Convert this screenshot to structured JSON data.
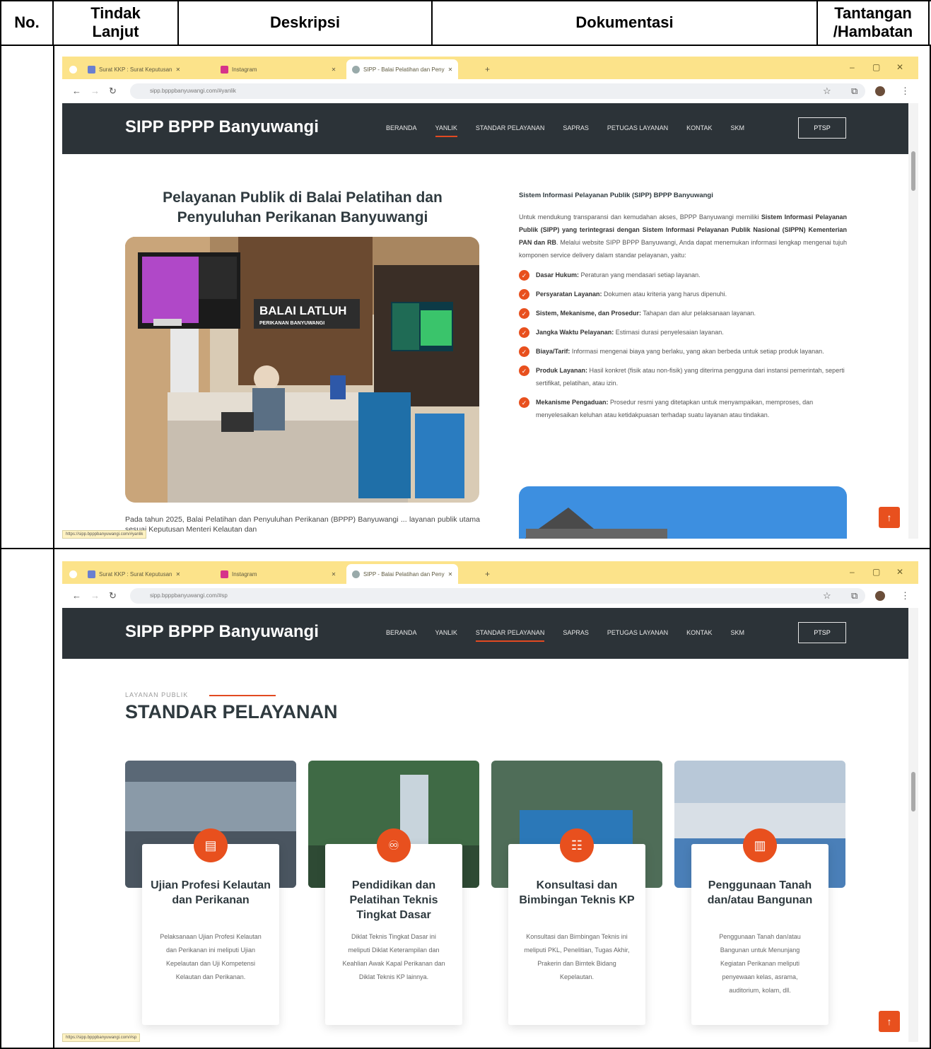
{
  "table": {
    "headers": [
      "No.",
      "Tindak Lanjut",
      "Deskripsi",
      "Dokumentasi",
      "Tantangan /Hambatan"
    ]
  },
  "browser": {
    "tabs": [
      "Surat KKP : Surat Keputusan",
      "Instagram",
      "SIPP - Balai Pelatihan dan Peny"
    ],
    "window_controls": [
      "–",
      "▢",
      "✕"
    ],
    "url1": "sipp.bpppbanyuwangi.com/#yanlik",
    "url2": "sipp.bpppbanyuwangi.com/#sp",
    "status1": "https://sipp.bpppbanyuwangi.com/#yanlik",
    "status2": "https://sipp.bpppbanyuwangi.com/#sp"
  },
  "site": {
    "brand": "SIPP BPPP Banyuwangi",
    "nav": [
      "BERANDA",
      "YANLIK",
      "STANDAR PELAYANAN",
      "SAPRAS",
      "PETUGAS LAYANAN",
      "KONTAK",
      "SKM"
    ],
    "ptsp": "PTSP"
  },
  "shot1": {
    "title": "Pelayanan Publik di Balai Pelatihan dan Penyuluhan Perikanan Banyuwangi",
    "photo_sign_1": "BALAI LATLUH",
    "photo_sign_2": "PERIKANAN BANYUWANGI",
    "para": "Pada tahun 2025, Balai Pelatihan dan Penyuluhan Perikanan (BPPP) Banyuwangi ... layanan publik utama sesuai Keputusan Menteri Kelautan dan",
    "right_heading": "Sistem Informasi Pelayanan Publik (SIPP) BPPP Banyuwangi",
    "right_intro_a": "Untuk mendukung transparansi dan kemudahan akses, BPPP Banyuwangi memiliki ",
    "right_intro_b": "Sistem Informasi Pelayanan Publik (SIPP) yang terintegrasi dengan Sistem Informasi Pelayanan Publik Nasional (SIPPN) Kementerian PAN dan RB",
    "right_intro_c": ". Melalui website SIPP BPPP Banyuwangi, Anda dapat menemukan informasi lengkap mengenai tujuh komponen service delivery dalam standar pelayanan, yaitu:",
    "items": [
      {
        "term": "Dasar Hukum:",
        "desc": " Peraturan yang mendasari setiap layanan."
      },
      {
        "term": "Persyaratan Layanan:",
        "desc": " Dokumen atau kriteria yang harus dipenuhi."
      },
      {
        "term": "Sistem, Mekanisme, dan Prosedur:",
        "desc": " Tahapan dan alur pelaksanaan layanan."
      },
      {
        "term": "Jangka Waktu Pelayanan:",
        "desc": " Estimasi durasi penyelesaian layanan."
      },
      {
        "term": "Biaya/Tarif:",
        "desc": " Informasi mengenai biaya yang berlaku, yang akan berbeda untuk setiap produk layanan."
      },
      {
        "term": "Produk Layanan:",
        "desc": " Hasil konkret (fisik atau non-fisik) yang diterima pengguna dari instansi pemerintah, seperti sertifikat, pelatihan, atau izin."
      },
      {
        "term": "Mekanisme Pengaduan:",
        "desc": " Prosedur resmi yang ditetapkan untuk menyampaikan, memproses, dan menyelesaikan keluhan atau ketidakpuasan terhadap suatu layanan atau tindakan."
      }
    ]
  },
  "shot2": {
    "eyebrow": "LAYANAN PUBLIK",
    "title": "STANDAR PELAYANAN",
    "cards": [
      {
        "title": "Ujian Profesi Kelautan dan Perikanan",
        "desc": "Pelaksanaan Ujian Profesi Kelautan dan Perikanan ini meliputi Ujian Kepelautan dan Uji Kompetensi Kelautan dan Perikanan.",
        "icon": "certificate-icon"
      },
      {
        "title": "Pendidikan dan Pelatihan Teknis Tingkat Dasar",
        "desc": "Diklat Teknis Tingkat Dasar ini meliputi Diklat Keterampilan dan Keahlian Awak Kapal Perikanan dan Diklat Teknis KP lainnya.",
        "icon": "group-icon"
      },
      {
        "title": "Konsultasi dan Bimbingan Teknis KP",
        "desc": "Konsultasi dan Bimbingan Teknis ini meliputi PKL, Penelitian, Tugas Akhir, Prakerin dan Bimtek Bidang Kepelautan.",
        "icon": "consult-icon"
      },
      {
        "title": "Penggunaan Tanah dan/atau Bangunan",
        "desc": "Penggunaan Tanah dan/atau Bangunan untuk Menunjang Kegiatan Perikanan meliputi penyewaan kelas, asrama, auditorium, kolam, dll.",
        "icon": "building-doc-icon"
      }
    ]
  },
  "colors": {
    "accent": "#e8501e",
    "navbar": "#2c3338",
    "tabbar": "#fce38a"
  }
}
